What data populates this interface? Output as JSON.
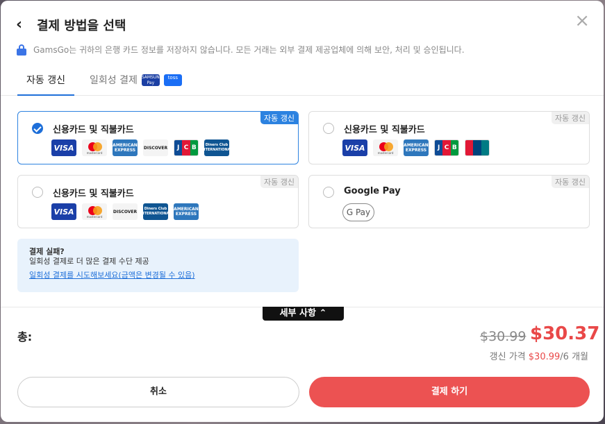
{
  "header": {
    "title": "결제 방법을 선택",
    "back_icon": "‹",
    "close_icon": "×"
  },
  "notice": "GamsGo는 귀하의 은행 카드 정보를 저장하지 않습니다. 모든 거래는 외부 결제 제공업체에 의해 보안, 처리 및 승인됩니다.",
  "tabs": {
    "auto_renew": "자동 갱신",
    "one_time": "일회성 결제",
    "samsung_pay_badge": "SAMSUNG Pay",
    "toss_badge": "toss"
  },
  "cards": [
    {
      "label": "신용카드 및 직불카드",
      "tag": "자동 갱신",
      "selected": true,
      "logos": [
        "VISA",
        "mastercard",
        "AMERICAN EXPRESS",
        "DISCOVER",
        "JCB",
        "Diners Club INTERNATIONAL"
      ]
    },
    {
      "label": "신용카드 및 직불카드",
      "tag": "자동 갱신",
      "selected": false,
      "logos": [
        "VISA",
        "mastercard",
        "AMERICAN EXPRESS",
        "JCB",
        "UnionPay 银联"
      ]
    },
    {
      "label": "신용카드 및 직불카드",
      "tag": "자동 갱신",
      "selected": false,
      "logos": [
        "VISA",
        "mastercard",
        "DISCOVER",
        "Diners Club INTERNATIONAL",
        "AMERICAN EXPRESS"
      ]
    },
    {
      "label": "Google Pay",
      "tag": "자동 갱신",
      "selected": false,
      "logos": [
        "G Pay"
      ]
    }
  ],
  "help": {
    "title": "결제 실패?",
    "text": "일회성 결제로 더 많은 결제 수단 제공",
    "link": "일회성 결제를 시도해보세요(금액은 변경될 수 있음)"
  },
  "summary": {
    "details_button": "세부 사항 ⌃",
    "total_label": "총:",
    "original_price": "$30.99",
    "price": "$30.37",
    "renew_label": "갱신 가격",
    "renew_price": "$30.99",
    "renew_period": "/6 개월"
  },
  "actions": {
    "cancel": "취소",
    "pay": "결제 하기"
  },
  "colors": {
    "accent": "#1e6fd9",
    "price_red": "#e94848",
    "pay_button": "#ec5252"
  }
}
